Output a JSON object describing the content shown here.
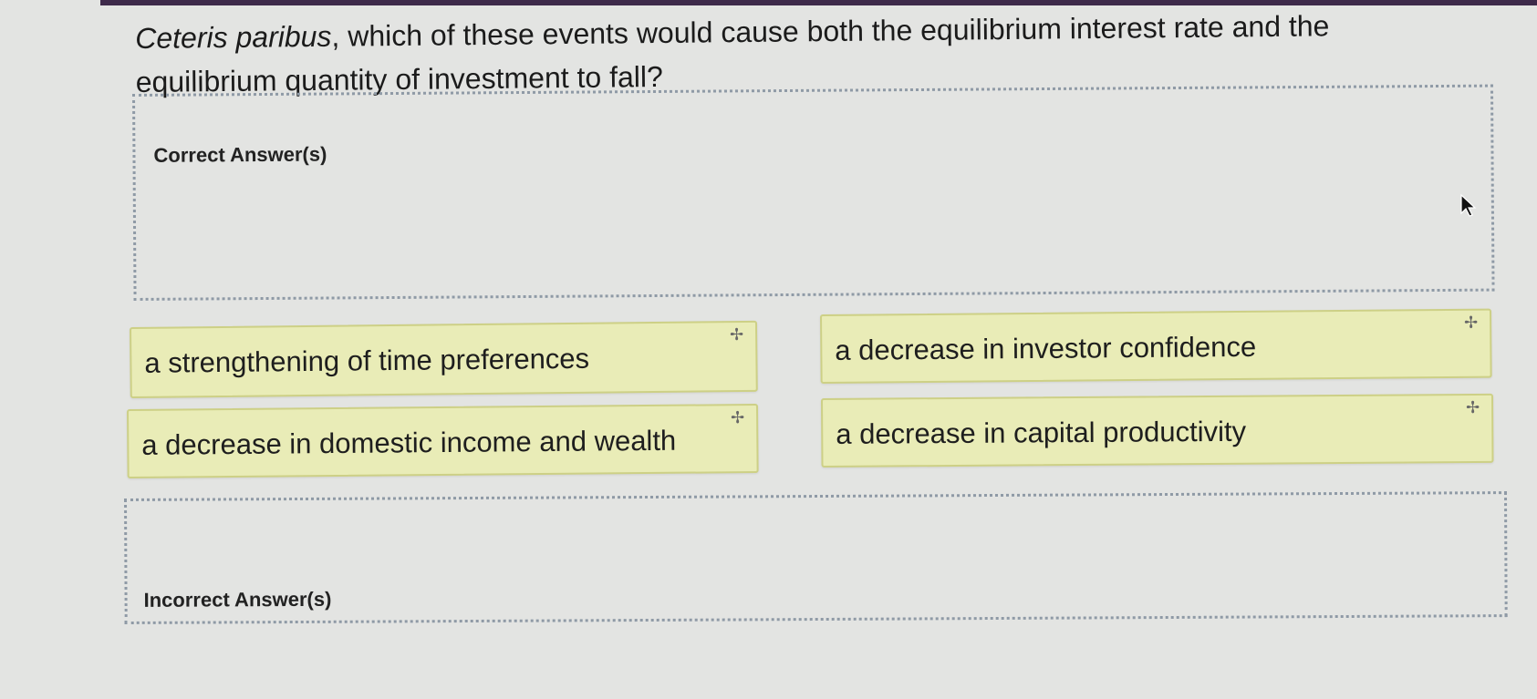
{
  "question": {
    "italic_part": "Ceteris paribus",
    "rest": ", which of these events would cause both the equilibrium interest rate and the equilibrium quantity of investment to fall?"
  },
  "zones": {
    "correct_label": "Correct Answer(s)",
    "incorrect_label": "Incorrect Answer(s)"
  },
  "answer_cards": [
    {
      "label": "a strengthening of time preferences",
      "icon": "move-icon"
    },
    {
      "label": "a decrease in investor confidence",
      "icon": "move-icon"
    },
    {
      "label": "a decrease in domestic income and wealth",
      "icon": "move-icon"
    },
    {
      "label": "a decrease in capital productivity",
      "icon": "move-icon"
    }
  ],
  "colors": {
    "card_background": "#e9ecb7",
    "card_border": "#cdd086",
    "dropzone_border": "#8f9aa6",
    "page_background": "#e3e4e2"
  }
}
